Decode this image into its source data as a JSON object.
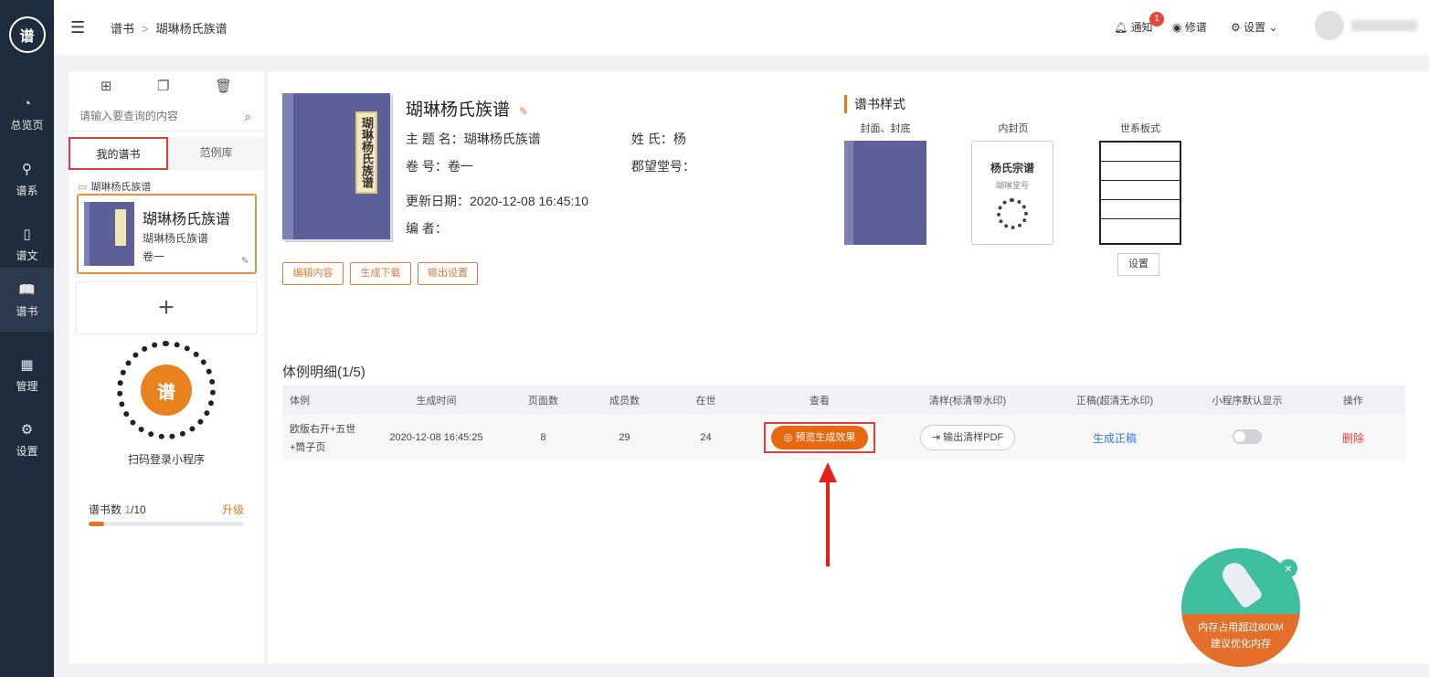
{
  "nav": {
    "logo": "谱",
    "items": [
      {
        "label": "总览页",
        "icon": "◔"
      },
      {
        "label": "谱系",
        "icon": "⚲"
      },
      {
        "label": "谱文",
        "icon": "▯"
      },
      {
        "label": "谱书",
        "icon": "📖"
      },
      {
        "label": "管理",
        "icon": "▦"
      },
      {
        "label": "设置",
        "icon": "⚙"
      }
    ]
  },
  "header": {
    "breadcrumb_root": "谱书",
    "breadcrumb_sep": ">",
    "breadcrumb_current": "瑚琳杨氏族谱",
    "notify_label": "通知",
    "notify_count": "1",
    "xiupu_label": "修谱",
    "settings_label": "设置"
  },
  "side": {
    "search_placeholder": "请输入要查询的内容",
    "tab_mine": "我的谱书",
    "tab_examples": "范例库",
    "folder_name": "瑚琳杨氏族谱",
    "book": {
      "title": "瑚琳杨氏族谱",
      "subtitle": "瑚琳杨氏族谱",
      "volume": "卷一"
    },
    "add_symbol": "+",
    "qr_center": "谱",
    "qr_label": "扫码登录小程序",
    "count_label": "谱书数",
    "count_used": "1",
    "count_total": "/10",
    "upgrade_label": "升级",
    "usage_fraction": 0.1
  },
  "book": {
    "cover_label": "瑚琳杨氏族谱",
    "title": "瑚琳杨氏族谱",
    "theme_label": "主  题  名：",
    "theme_value": "瑚琳杨氏族谱",
    "surname_label": "姓        氏：",
    "surname_value": "杨",
    "volume_label": "卷        号：",
    "volume_value": "卷一",
    "hall_label": "郡望堂号：",
    "hall_value": "",
    "updated_label": "更新日期：",
    "updated_value": "2020-12-08 16:45:10",
    "editor_label": "编        者：",
    "editor_value": "",
    "btn_edit": "编辑内容",
    "btn_generate": "生成下载",
    "btn_output": "输出设置"
  },
  "style": {
    "heading": "谱书样式",
    "cover_label": "封面、封底",
    "inner_label": "内封页",
    "series_label": "世系板式",
    "inner_title": "杨氏宗谱",
    "inner_sub": "瑚琳堂号",
    "set_btn": "设置"
  },
  "detail": {
    "heading": "体例明细(1/5)",
    "columns": [
      "体例",
      "生成时间",
      "页面数",
      "成员数",
      "在世",
      "查看",
      "清样(标清带水印)",
      "正稿(超清无水印)",
      "小程序默认显示",
      "操作"
    ],
    "row": {
      "style_line1": "欧版右开+五世",
      "style_line2": "+筒子页",
      "time": "2020-12-08 16:45:25",
      "pages": "8",
      "members": "29",
      "alive": "24",
      "preview_btn": "预览生成效果",
      "pdf_btn": "输出清样PDF",
      "final_link": "生成正稿",
      "delete_link": "删除"
    }
  },
  "widget": {
    "line1": "内存占用超过800M",
    "line2": "建议优化内存",
    "close": "×"
  },
  "colors": {
    "accent": "#e8680f",
    "nav_bg": "#1f2c3d",
    "highlight": "#e23b3b"
  }
}
